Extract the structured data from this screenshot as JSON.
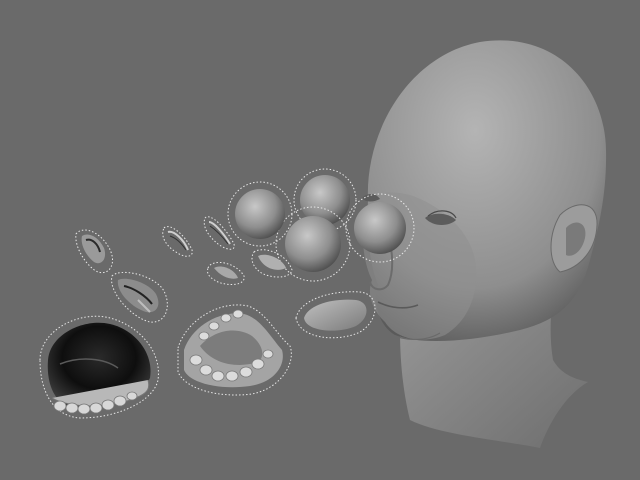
{
  "viewport": {
    "background": "#6a6a6a",
    "selection_color": "#e8e8e8",
    "mesh_color": "#9a9a9a"
  },
  "scene": {
    "objects": [
      {
        "name": "head",
        "selected": false
      },
      {
        "name": "eyeball-left",
        "selected": true
      },
      {
        "name": "eyeball-right",
        "selected": true
      },
      {
        "name": "eyeball-upper",
        "selected": true
      },
      {
        "name": "eyeball-middle",
        "selected": true
      },
      {
        "name": "eyeball-front",
        "selected": true
      },
      {
        "name": "tongue",
        "selected": true
      },
      {
        "name": "lower-teeth-gums",
        "selected": true
      },
      {
        "name": "upper-teeth-palate",
        "selected": true
      },
      {
        "name": "eyelash-pieces",
        "selected": true
      }
    ]
  }
}
